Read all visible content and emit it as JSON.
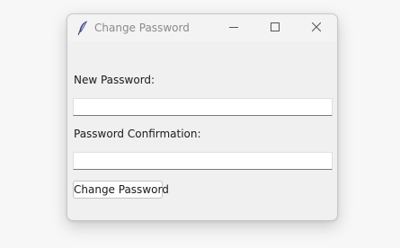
{
  "window": {
    "title": "Change Password",
    "app_icon": "feather-icon"
  },
  "form": {
    "new_password_label": "New Password:",
    "new_password_value": "",
    "confirm_label": "Password Confirmation:",
    "confirm_value": "",
    "submit_label": "Change Password"
  },
  "colors": {
    "window_bg": "#f0f0f0",
    "title_text": "#8a8a8a",
    "field_underline": "#7a7a7a"
  }
}
